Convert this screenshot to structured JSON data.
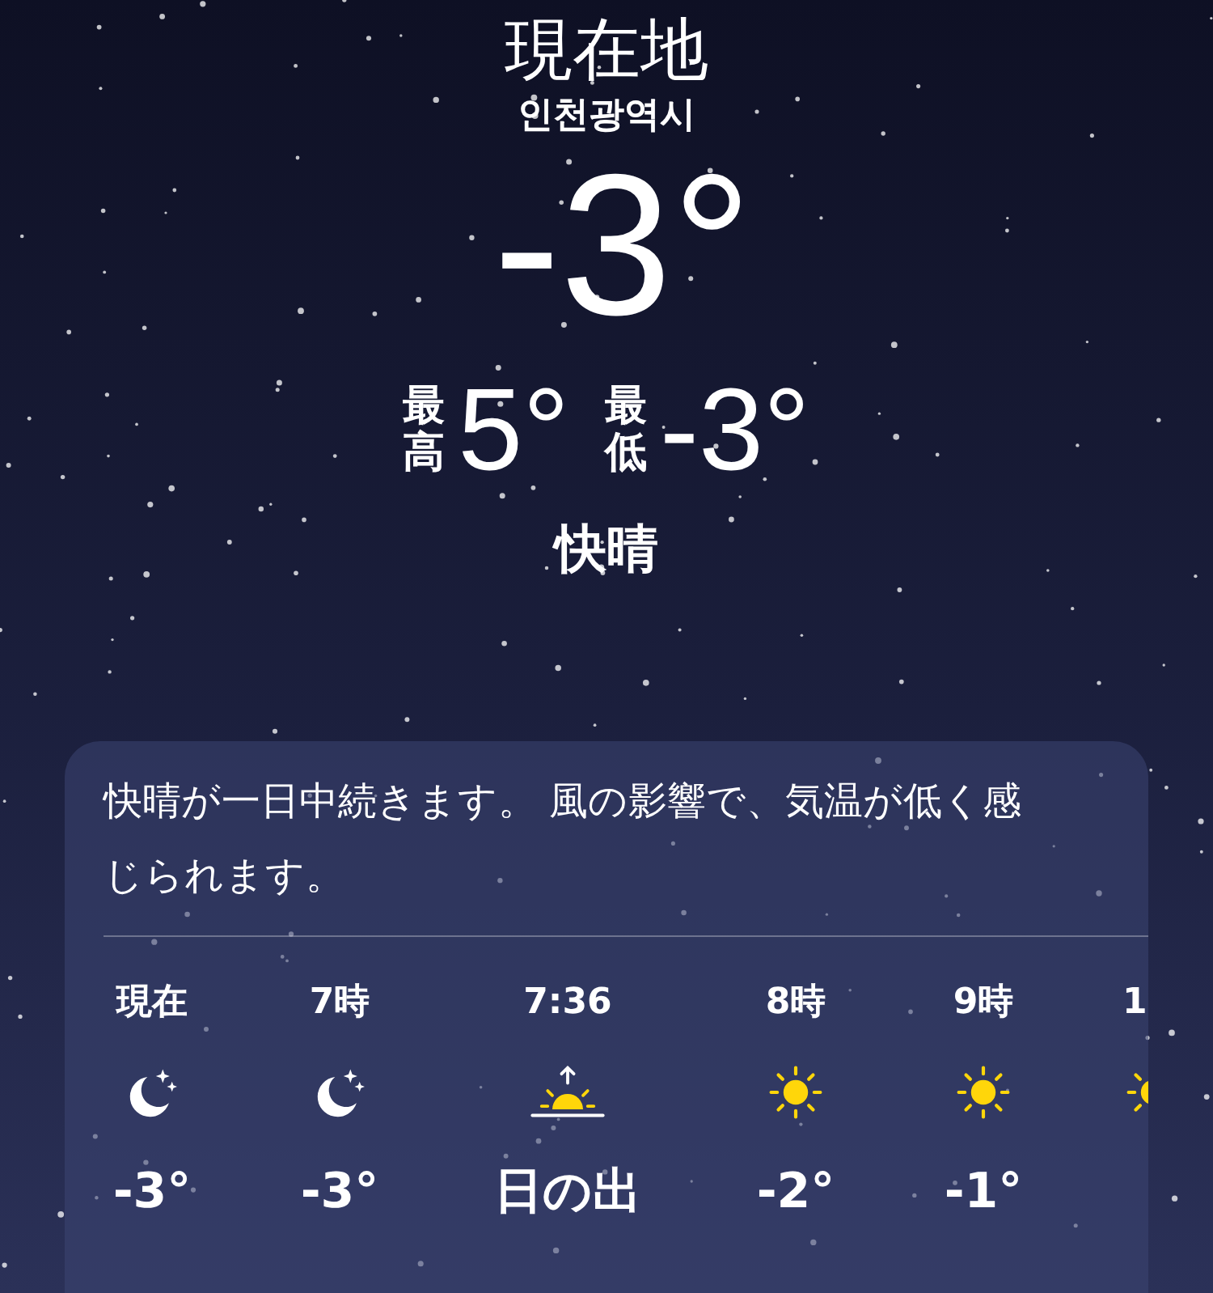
{
  "location": {
    "title": "現在地",
    "subtitle": "인천광역시",
    "temperature": "-3°",
    "high_label": "最高",
    "high": "5°",
    "low_label": "最低",
    "low": "-3°",
    "condition": "快晴"
  },
  "forecast": {
    "summary": "快晴が一日中続きます。 風の影響で、気温が低く感じられます。",
    "hours": [
      {
        "time": "現在",
        "kind": "moon",
        "temp": "-3°"
      },
      {
        "time": "7時",
        "kind": "moon",
        "temp": "-3°"
      },
      {
        "time": "7:36",
        "kind": "sunrise",
        "temp": "日の出"
      },
      {
        "time": "8時",
        "kind": "sun",
        "temp": "-2°"
      },
      {
        "time": "9時",
        "kind": "sun",
        "temp": "-1°"
      },
      {
        "time": "1",
        "kind": "sun"
      }
    ]
  }
}
